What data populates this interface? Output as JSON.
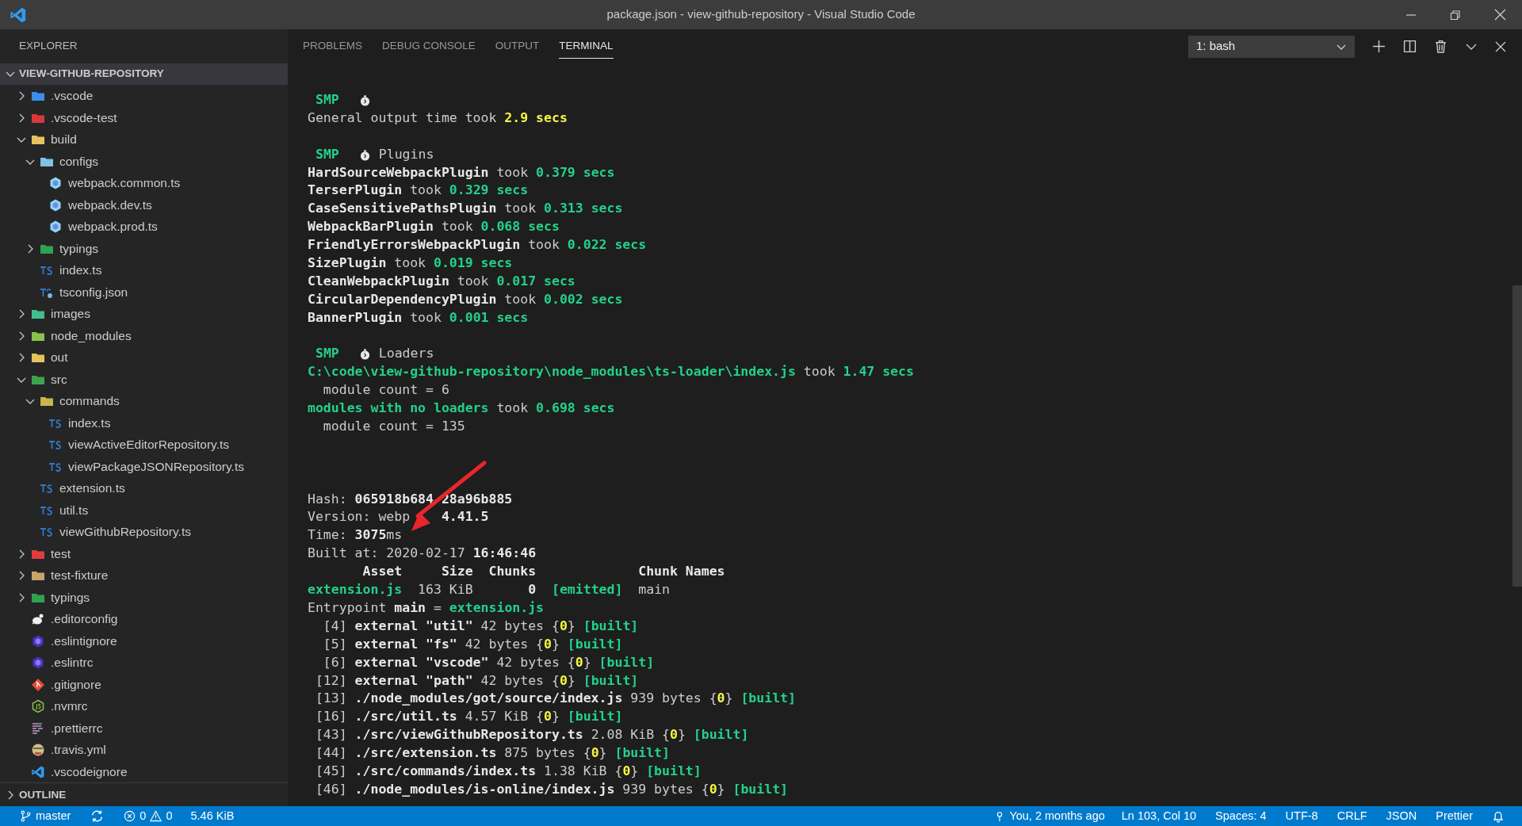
{
  "window": {
    "title": "package.json - view-github-repository - Visual Studio Code"
  },
  "sidebar": {
    "title": "EXPLORER",
    "root": {
      "label": "VIEW-GITHUB-REPOSITORY",
      "expanded": true
    },
    "tree": [
      {
        "label": ".vscode",
        "kind": "folder",
        "color": "#3b8eea",
        "expanded": false
      },
      {
        "label": ".vscode-test",
        "kind": "folder",
        "color": "#d9383a",
        "expanded": false
      },
      {
        "label": "build",
        "kind": "folder",
        "color": "#e6c35c",
        "expanded": true,
        "children": [
          {
            "label": "configs",
            "kind": "folder",
            "color": "#7ec3e6",
            "expanded": true,
            "children": [
              {
                "label": "webpack.common.ts",
                "kind": "webpack"
              },
              {
                "label": "webpack.dev.ts",
                "kind": "webpack"
              },
              {
                "label": "webpack.prod.ts",
                "kind": "webpack"
              }
            ]
          },
          {
            "label": "typings",
            "kind": "folder",
            "color": "#2ea44f",
            "expanded": false
          },
          {
            "label": "index.ts",
            "kind": "ts"
          },
          {
            "label": "tsconfig.json",
            "kind": "tsconfig"
          }
        ]
      },
      {
        "label": "images",
        "kind": "folder",
        "color": "#3fbf8f",
        "expanded": false
      },
      {
        "label": "node_modules",
        "kind": "folder",
        "color": "#8bc34a",
        "expanded": false
      },
      {
        "label": "out",
        "kind": "folder",
        "color": "#e6c35c",
        "expanded": false
      },
      {
        "label": "src",
        "kind": "folder",
        "color": "#3fa34d",
        "expanded": true,
        "children": [
          {
            "label": "commands",
            "kind": "folder",
            "color": "#c8b648",
            "expanded": true,
            "children": [
              {
                "label": "index.ts",
                "kind": "ts"
              },
              {
                "label": "viewActiveEditorRepository.ts",
                "kind": "ts"
              },
              {
                "label": "viewPackageJSONRepository.ts",
                "kind": "ts"
              }
            ]
          },
          {
            "label": "extension.ts",
            "kind": "ts"
          },
          {
            "label": "util.ts",
            "kind": "ts"
          },
          {
            "label": "viewGithubRepository.ts",
            "kind": "ts"
          }
        ]
      },
      {
        "label": "test",
        "kind": "folder",
        "color": "#e03e3e",
        "expanded": false
      },
      {
        "label": "test-fixture",
        "kind": "folder",
        "color": "#c9a46a",
        "expanded": false
      },
      {
        "label": "typings",
        "kind": "folder",
        "color": "#2ea44f",
        "expanded": false
      },
      {
        "label": ".editorconfig",
        "kind": "editorconfig"
      },
      {
        "label": ".eslintignore",
        "kind": "eslint"
      },
      {
        "label": ".eslintrc",
        "kind": "eslint"
      },
      {
        "label": ".gitignore",
        "kind": "git"
      },
      {
        "label": ".nvmrc",
        "kind": "node"
      },
      {
        "label": ".prettierrc",
        "kind": "prettier"
      },
      {
        "label": ".travis.yml",
        "kind": "travis"
      },
      {
        "label": ".vscodeignore",
        "kind": "vscode"
      }
    ],
    "outline": {
      "label": "OUTLINE",
      "expanded": false
    }
  },
  "panel": {
    "tabs": [
      {
        "label": "PROBLEMS",
        "selected": false
      },
      {
        "label": "DEBUG CONSOLE",
        "selected": false
      },
      {
        "label": "OUTPUT",
        "selected": false
      },
      {
        "label": "TERMINAL",
        "selected": true
      }
    ],
    "terminal_select": {
      "value": "1: bash"
    },
    "lines": [
      {
        "kind": "header",
        "tag": "SMP"
      },
      {
        "kind": "text",
        "spans": [
          {
            "text": "General output time took ",
            "kind": "plain"
          },
          {
            "text": "2.9 secs",
            "kind": "yellow"
          }
        ]
      },
      {
        "kind": "blank"
      },
      {
        "kind": "header",
        "tag": "SMP",
        "label": "Plugins"
      },
      {
        "kind": "text",
        "spans": [
          {
            "text": "HardSourceWebpackPlugin",
            "kind": "bold"
          },
          {
            "text": " took ",
            "kind": "plain"
          },
          {
            "text": "0.379 secs",
            "kind": "green"
          }
        ]
      },
      {
        "kind": "text",
        "spans": [
          {
            "text": "TerserPlugin",
            "kind": "bold"
          },
          {
            "text": " took ",
            "kind": "plain"
          },
          {
            "text": "0.329 secs",
            "kind": "green"
          }
        ]
      },
      {
        "kind": "text",
        "spans": [
          {
            "text": "CaseSensitivePathsPlugin",
            "kind": "bold"
          },
          {
            "text": " took ",
            "kind": "plain"
          },
          {
            "text": "0.313 secs",
            "kind": "green"
          }
        ]
      },
      {
        "kind": "text",
        "spans": [
          {
            "text": "WebpackBarPlugin",
            "kind": "bold"
          },
          {
            "text": " took ",
            "kind": "plain"
          },
          {
            "text": "0.068 secs",
            "kind": "green"
          }
        ]
      },
      {
        "kind": "text",
        "spans": [
          {
            "text": "FriendlyErrorsWebpackPlugin",
            "kind": "bold"
          },
          {
            "text": " took ",
            "kind": "plain"
          },
          {
            "text": "0.022 secs",
            "kind": "green"
          }
        ]
      },
      {
        "kind": "text",
        "spans": [
          {
            "text": "SizePlugin",
            "kind": "bold"
          },
          {
            "text": " took ",
            "kind": "plain"
          },
          {
            "text": "0.019 secs",
            "kind": "green"
          }
        ]
      },
      {
        "kind": "text",
        "spans": [
          {
            "text": "CleanWebpackPlugin",
            "kind": "bold"
          },
          {
            "text": " took ",
            "kind": "plain"
          },
          {
            "text": "0.017 secs",
            "kind": "green"
          }
        ]
      },
      {
        "kind": "text",
        "spans": [
          {
            "text": "CircularDependencyPlugin",
            "kind": "bold"
          },
          {
            "text": " took ",
            "kind": "plain"
          },
          {
            "text": "0.002 secs",
            "kind": "green"
          }
        ]
      },
      {
        "kind": "text",
        "spans": [
          {
            "text": "BannerPlugin",
            "kind": "bold"
          },
          {
            "text": " took ",
            "kind": "plain"
          },
          {
            "text": "0.001 secs",
            "kind": "green"
          }
        ]
      },
      {
        "kind": "blank"
      },
      {
        "kind": "header",
        "tag": "SMP",
        "label": "Loaders"
      },
      {
        "kind": "text",
        "spans": [
          {
            "text": "C:\\code\\view-github-repository\\node_modules\\ts-loader\\index.js",
            "kind": "green"
          },
          {
            "text": " took ",
            "kind": "plain"
          },
          {
            "text": "1.47 secs",
            "kind": "green"
          }
        ]
      },
      {
        "kind": "text",
        "spans": [
          {
            "text": "  module count = 6",
            "kind": "plain"
          }
        ]
      },
      {
        "kind": "text",
        "spans": [
          {
            "text": "modules with no loaders",
            "kind": "green"
          },
          {
            "text": " took ",
            "kind": "plain"
          },
          {
            "text": "0.698 secs",
            "kind": "green"
          }
        ]
      },
      {
        "kind": "text",
        "spans": [
          {
            "text": "  module count = 135",
            "kind": "plain"
          }
        ]
      },
      {
        "kind": "blank"
      },
      {
        "kind": "blank"
      },
      {
        "kind": "blank"
      },
      {
        "kind": "text",
        "spans": [
          {
            "text": "Hash: ",
            "kind": "plain"
          },
          {
            "text": "065918b684",
            "kind": "bold"
          },
          {
            "text": " 28a96b885",
            "kind": "bold"
          }
        ]
      },
      {
        "kind": "text",
        "spans": [
          {
            "text": "Version: webp",
            "kind": "plain"
          },
          {
            "text": "    4.41.5",
            "kind": "bold"
          }
        ]
      },
      {
        "kind": "text",
        "spans": [
          {
            "text": "Time: ",
            "kind": "plain"
          },
          {
            "text": "3075",
            "kind": "bold"
          },
          {
            "text": "ms",
            "kind": "plain"
          }
        ]
      },
      {
        "kind": "text",
        "spans": [
          {
            "text": "Built at: 2020-02-17 ",
            "kind": "plain"
          },
          {
            "text": "16:46:46",
            "kind": "bold"
          }
        ]
      },
      {
        "kind": "text",
        "spans": [
          {
            "text": "       Asset     Size  Chunks             Chunk Names",
            "kind": "bold"
          }
        ]
      },
      {
        "kind": "text",
        "spans": [
          {
            "text": "extension.js",
            "kind": "green"
          },
          {
            "text": "  163 KiB       ",
            "kind": "plain"
          },
          {
            "text": "0  ",
            "kind": "bold"
          },
          {
            "text": "[emitted]",
            "kind": "green"
          },
          {
            "text": "  main",
            "kind": "plain"
          }
        ]
      },
      {
        "kind": "text",
        "spans": [
          {
            "text": "Entrypoint ",
            "kind": "plain"
          },
          {
            "text": "main",
            "kind": "bold"
          },
          {
            "text": " = ",
            "kind": "plain"
          },
          {
            "text": "extension.js",
            "kind": "green"
          }
        ]
      },
      {
        "kind": "text",
        "spans": [
          {
            "text": "  [4] ",
            "kind": "plain"
          },
          {
            "text": "external \"util\"",
            "kind": "bold"
          },
          {
            "text": " 42 bytes {",
            "kind": "plain"
          },
          {
            "text": "0",
            "kind": "yellow"
          },
          {
            "text": "} ",
            "kind": "plain"
          },
          {
            "text": "[built]",
            "kind": "green"
          }
        ]
      },
      {
        "kind": "text",
        "spans": [
          {
            "text": "  [5] ",
            "kind": "plain"
          },
          {
            "text": "external \"fs\"",
            "kind": "bold"
          },
          {
            "text": " 42 bytes {",
            "kind": "plain"
          },
          {
            "text": "0",
            "kind": "yellow"
          },
          {
            "text": "} ",
            "kind": "plain"
          },
          {
            "text": "[built]",
            "kind": "green"
          }
        ]
      },
      {
        "kind": "text",
        "spans": [
          {
            "text": "  [6] ",
            "kind": "plain"
          },
          {
            "text": "external \"vscode\"",
            "kind": "bold"
          },
          {
            "text": " 42 bytes {",
            "kind": "plain"
          },
          {
            "text": "0",
            "kind": "yellow"
          },
          {
            "text": "} ",
            "kind": "plain"
          },
          {
            "text": "[built]",
            "kind": "green"
          }
        ]
      },
      {
        "kind": "text",
        "spans": [
          {
            "text": " [12] ",
            "kind": "plain"
          },
          {
            "text": "external \"path\"",
            "kind": "bold"
          },
          {
            "text": " 42 bytes {",
            "kind": "plain"
          },
          {
            "text": "0",
            "kind": "yellow"
          },
          {
            "text": "} ",
            "kind": "plain"
          },
          {
            "text": "[built]",
            "kind": "green"
          }
        ]
      },
      {
        "kind": "text",
        "spans": [
          {
            "text": " [13] ",
            "kind": "plain"
          },
          {
            "text": "./node_modules/got/source/index.js",
            "kind": "bold"
          },
          {
            "text": " 939 bytes {",
            "kind": "plain"
          },
          {
            "text": "0",
            "kind": "yellow"
          },
          {
            "text": "} ",
            "kind": "plain"
          },
          {
            "text": "[built]",
            "kind": "green"
          }
        ]
      },
      {
        "kind": "text",
        "spans": [
          {
            "text": " [16] ",
            "kind": "plain"
          },
          {
            "text": "./src/util.ts",
            "kind": "bold"
          },
          {
            "text": " 4.57 KiB {",
            "kind": "plain"
          },
          {
            "text": "0",
            "kind": "yellow"
          },
          {
            "text": "} ",
            "kind": "plain"
          },
          {
            "text": "[built]",
            "kind": "green"
          }
        ]
      },
      {
        "kind": "text",
        "spans": [
          {
            "text": " [43] ",
            "kind": "plain"
          },
          {
            "text": "./src/viewGithubRepository.ts",
            "kind": "bold"
          },
          {
            "text": " 2.08 KiB {",
            "kind": "plain"
          },
          {
            "text": "0",
            "kind": "yellow"
          },
          {
            "text": "} ",
            "kind": "plain"
          },
          {
            "text": "[built]",
            "kind": "green"
          }
        ]
      },
      {
        "kind": "text",
        "spans": [
          {
            "text": " [44] ",
            "kind": "plain"
          },
          {
            "text": "./src/extension.ts",
            "kind": "bold"
          },
          {
            "text": " 875 bytes {",
            "kind": "plain"
          },
          {
            "text": "0",
            "kind": "yellow"
          },
          {
            "text": "} ",
            "kind": "plain"
          },
          {
            "text": "[built]",
            "kind": "green"
          }
        ]
      },
      {
        "kind": "text",
        "spans": [
          {
            "text": " [45] ",
            "kind": "plain"
          },
          {
            "text": "./src/commands/index.ts",
            "kind": "bold"
          },
          {
            "text": " 1.38 KiB {",
            "kind": "plain"
          },
          {
            "text": "0",
            "kind": "yellow"
          },
          {
            "text": "} ",
            "kind": "plain"
          },
          {
            "text": "[built]",
            "kind": "green"
          }
        ]
      },
      {
        "kind": "text",
        "spans": [
          {
            "text": " [46] ",
            "kind": "plain"
          },
          {
            "text": "./node_modules/is-online/index.js",
            "kind": "bold"
          },
          {
            "text": " 939 bytes {",
            "kind": "plain"
          },
          {
            "text": "0",
            "kind": "yellow"
          },
          {
            "text": "} ",
            "kind": "plain"
          },
          {
            "text": "[built]",
            "kind": "green"
          }
        ]
      }
    ]
  },
  "status_bar": {
    "branch": "master",
    "errors": "0",
    "warnings": "0",
    "size": "5.46 KiB",
    "right": [
      {
        "kind": "blame",
        "text": "You, 2 months ago"
      },
      {
        "kind": "text",
        "text": "Ln 103, Col 10"
      },
      {
        "kind": "text",
        "text": "Spaces: 4"
      },
      {
        "kind": "text",
        "text": "UTF-8"
      },
      {
        "kind": "text",
        "text": "CRLF"
      },
      {
        "kind": "text",
        "text": "JSON"
      },
      {
        "kind": "text",
        "text": "Prettier"
      },
      {
        "kind": "bell"
      }
    ]
  }
}
